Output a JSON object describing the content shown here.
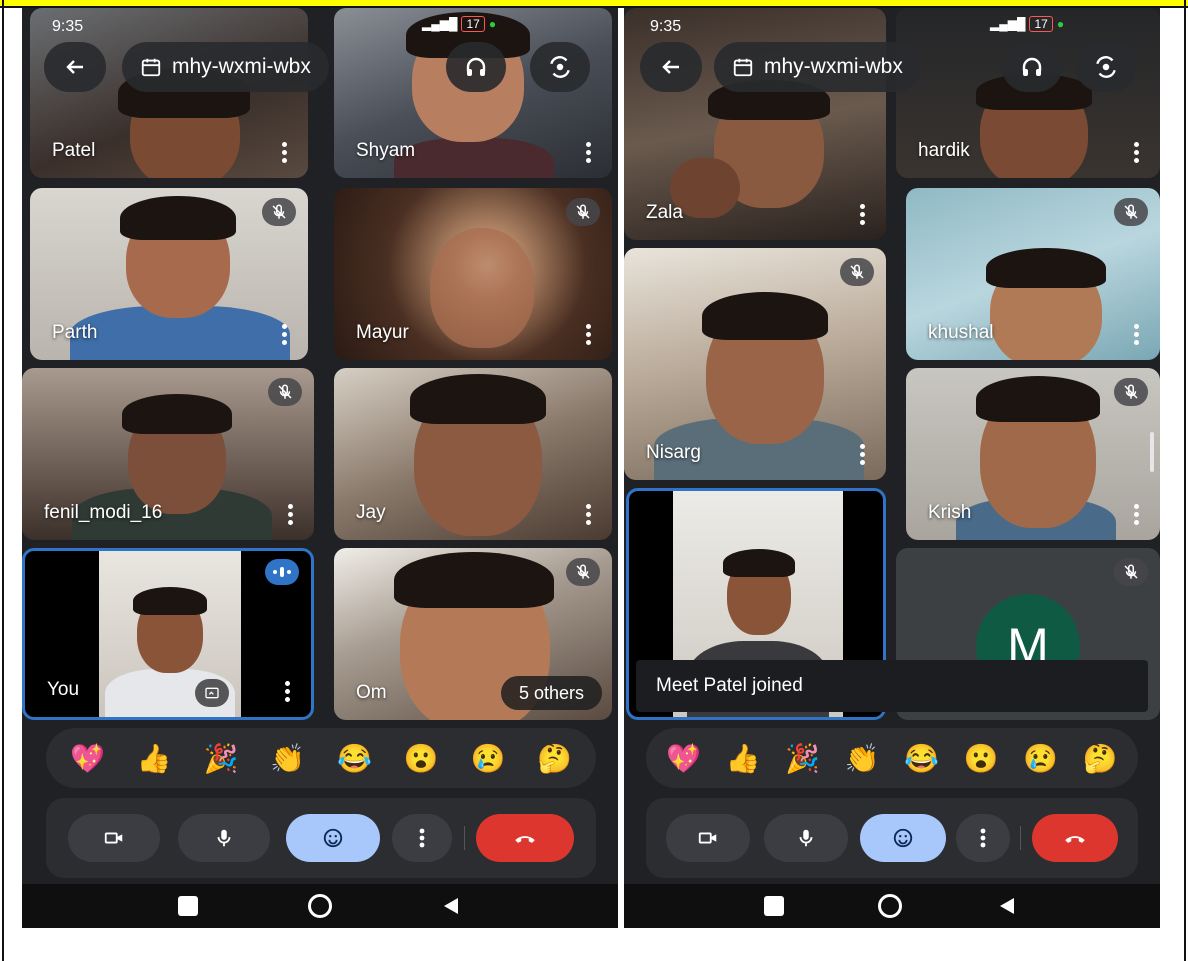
{
  "status_bar": {
    "time": "9:35",
    "battery": "17"
  },
  "meeting": {
    "code": "mhy-wxmi-wbx"
  },
  "left": {
    "participants": [
      {
        "name": "Patel"
      },
      {
        "name": "Shyam"
      },
      {
        "name": "Parth"
      },
      {
        "name": "Mayur"
      },
      {
        "name": "fenil_modi_16"
      },
      {
        "name": "Jay"
      },
      {
        "name": "You"
      },
      {
        "name": "Om"
      }
    ],
    "others_label": "5 others"
  },
  "right": {
    "participants": [
      {
        "name": "Zala"
      },
      {
        "name": "hardik"
      },
      {
        "name": "khushal"
      },
      {
        "name": "Nisarg"
      },
      {
        "name": "Krish"
      }
    ],
    "avatar_letter": "M",
    "toast": "Meet Patel joined"
  },
  "reactions": [
    "💖",
    "👍",
    "🎉",
    "👏",
    "😂",
    "😮",
    "😢",
    "🤔"
  ],
  "colors": {
    "accent": "#2f74c7",
    "end_call": "#dc362e",
    "selected": "#a8c7fa",
    "avatar": "#0f5a43"
  }
}
